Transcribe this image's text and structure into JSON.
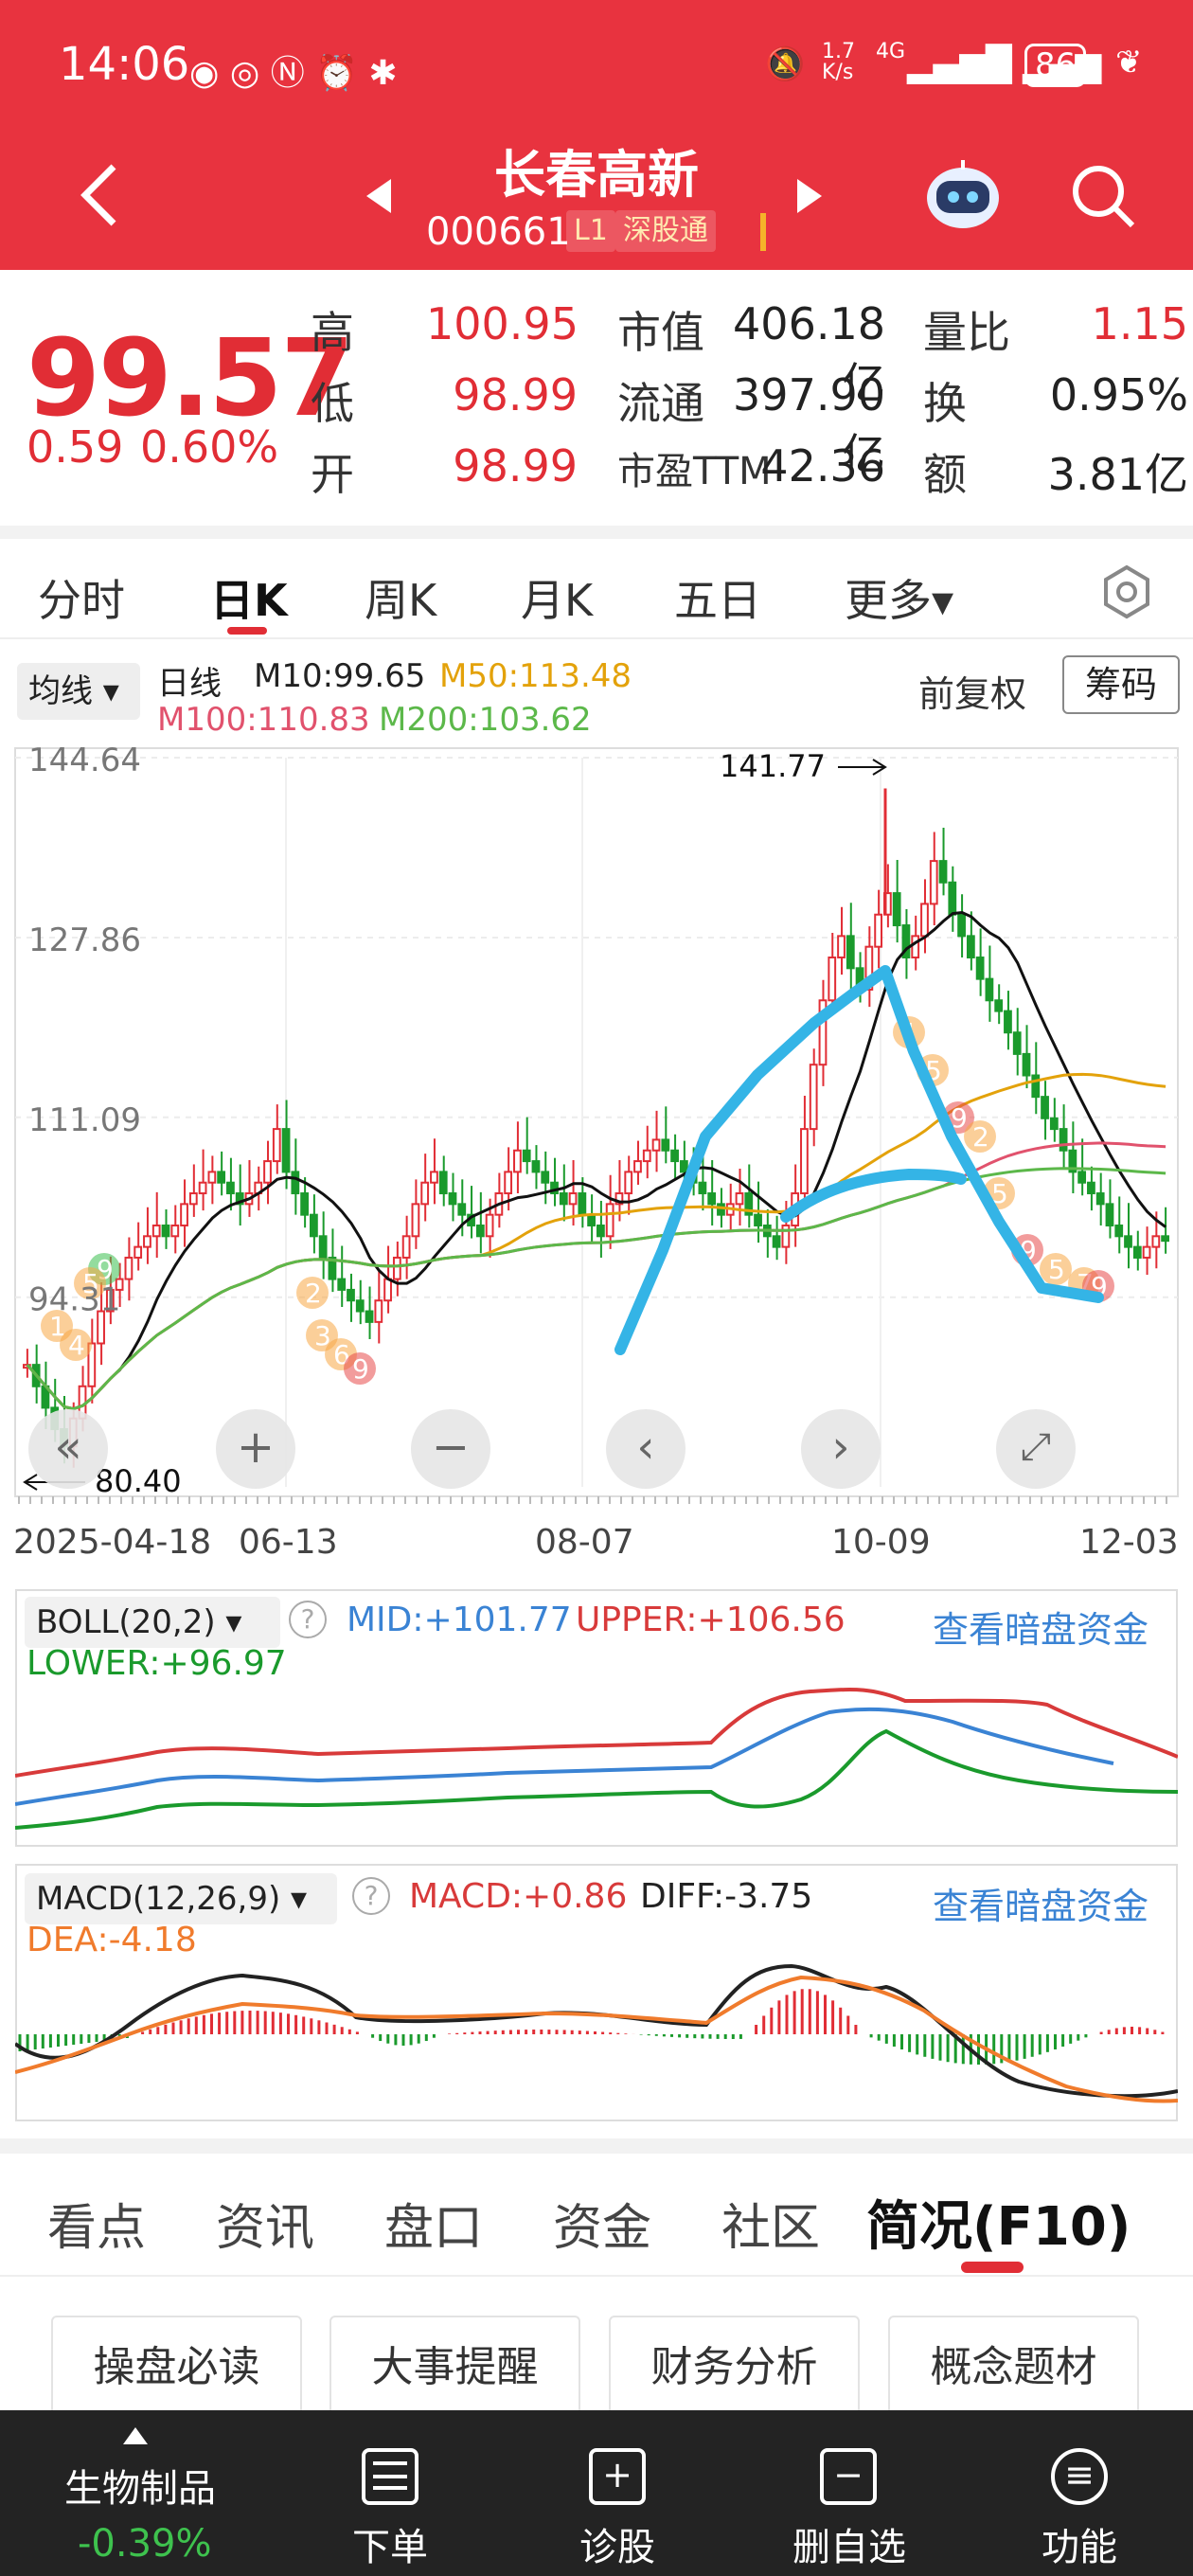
{
  "status_bar": {
    "time": "14:06",
    "net_speed_top": "1.7",
    "net_speed_unit": "K/s",
    "network": "4G",
    "battery": "86"
  },
  "header": {
    "stock_name": "长春高新",
    "stock_code": "000661",
    "level_badge": "L1",
    "connect_badge": "深股通"
  },
  "quote": {
    "price": "99.57",
    "change": "0.59",
    "change_pct": "0.60%",
    "rows": [
      {
        "l1": "高",
        "v1": "100.95",
        "l2": "市值",
        "v2": "406.18亿",
        "l3": "量比",
        "v3": "1.15"
      },
      {
        "l1": "低",
        "v1": "98.99",
        "l2": "流通",
        "v2": "397.90亿",
        "l3": "换",
        "v3": "0.95%"
      },
      {
        "l1": "开",
        "v1": "98.99",
        "l2": "市盈TTM",
        "v2": "42.36",
        "l3": "额",
        "v3": "3.81亿"
      }
    ]
  },
  "period_tabs": [
    "分时",
    "日K",
    "周K",
    "月K",
    "五日",
    "更多▾"
  ],
  "chart_controls": {
    "ma_select": "均线",
    "period_label": "日线",
    "m10": "M10:99.65",
    "m50": "M50:113.48",
    "m100": "M100:110.83",
    "m200": "M200:103.62",
    "adjust": "前复权",
    "chips": "筹码"
  },
  "chart_data": {
    "type": "candlestick",
    "y_ticks": [
      "144.64",
      "127.86",
      "111.09",
      "94.31"
    ],
    "high_marker": "141.77",
    "low_marker": "80.40",
    "x_ticks": [
      "2025-04-18",
      "06-13",
      "08-07",
      "10-09",
      "12-03"
    ],
    "ylim": [
      77.5,
      144.64
    ]
  },
  "boll": {
    "select": "BOLL(20,2)",
    "mid": "MID:+101.77",
    "upper": "UPPER:+106.56",
    "lower": "LOWER:+96.97",
    "link": "查看暗盘资金"
  },
  "macd": {
    "select": "MACD(12,26,9)",
    "macd": "MACD:+0.86",
    "diff": "DIFF:-3.75",
    "dea": "DEA:-4.18",
    "link": "查看暗盘资金"
  },
  "bottom_tabs": [
    "看点",
    "资讯",
    "盘口",
    "资金",
    "社区",
    "简况(F10)"
  ],
  "pills": [
    "操盘必读",
    "大事提醒",
    "财务分析",
    "概念题材"
  ],
  "bottom_bar": {
    "sector": "生物制品",
    "sector_change": "-0.39%",
    "items": [
      "下单",
      "诊股",
      "删自选",
      "功能"
    ]
  },
  "colors": {
    "brand": "#e8333f",
    "up": "#e12d35",
    "down": "#1a9a2c"
  }
}
